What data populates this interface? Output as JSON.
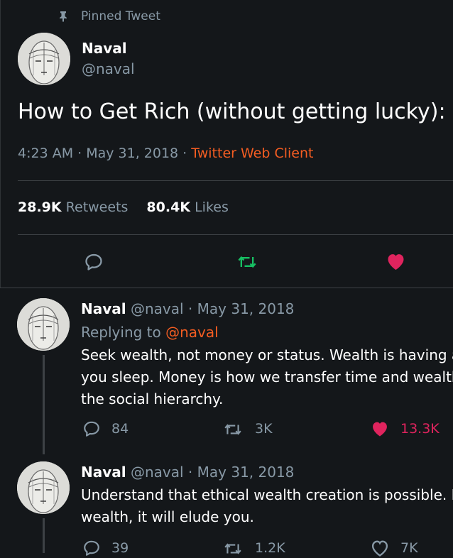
{
  "pinned": {
    "label": "Pinned Tweet"
  },
  "main_tweet": {
    "name": "Naval",
    "handle": "@naval",
    "text": "How to Get Rich (without getting lucky):",
    "timestamp": "4:23 AM · May 31, 2018 · ",
    "source": "Twitter Web Client",
    "retweets_count": "28.9K",
    "retweets_label": "Retweets",
    "likes_count": "80.4K",
    "likes_label": "Likes"
  },
  "replies": [
    {
      "name": "Naval",
      "handle_date": "@naval · May 31, 2018",
      "replying_prefix": "Replying to ",
      "replying_mention": "@naval",
      "lines": [
        "Seek wealth, not money or status. Wealth is having assets that earn while",
        "you sleep. Money is how we transfer time and wealth. Status is your place in",
        "the social hierarchy."
      ],
      "reply_count": "84",
      "retweet_count": "3K",
      "like_count": "13.3K"
    },
    {
      "name": "Naval",
      "handle_date": "@naval · May 31, 2018",
      "lines": [
        "Understand that ethical wealth creation is possible. If you secretly despise",
        "wealth, it will elude you."
      ],
      "reply_count": "39",
      "retweet_count": "1.2K",
      "like_count": "7K"
    }
  ],
  "colors": {
    "background": "#14171a",
    "secondary_text": "#8899a6",
    "source_link": "#f45d22",
    "retweet_green": "#17bf63",
    "like_pink": "#e0245e"
  },
  "icons": {
    "pin": "pin-icon",
    "reply": "reply-icon",
    "retweet": "retweet-icon",
    "like": "heart-icon"
  }
}
